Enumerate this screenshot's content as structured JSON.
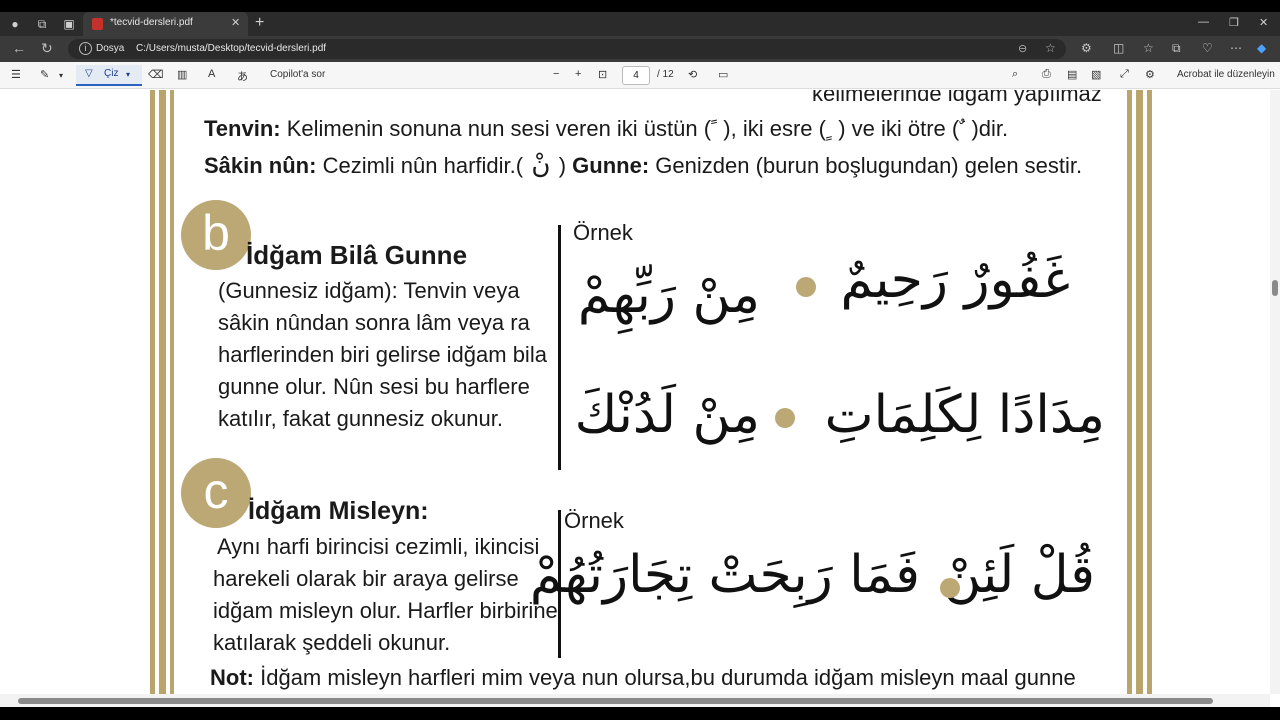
{
  "browser": {
    "tab_title": "*tecvid-dersleri.pdf",
    "site_label": "Dosya",
    "url": "C:/Users/musta/Desktop/tecvid-dersleri.pdf"
  },
  "pdf_toolbar": {
    "draw_label": "Çiz",
    "copilot_label": "Copilot'a sor",
    "page_current": "4",
    "page_total": "/ 12",
    "acrobat_label": "Acrobat ile düzenleyin"
  },
  "page": {
    "top_cut_text": "kelimelerinde idğam yapılmaz",
    "tenvin_term": "Tenvin:",
    "tenvin_def": "Kelimenin sonuna nun sesi veren iki üstün (",
    "tenvin_def2": "), iki esre (",
    "tenvin_def3": ") ve iki ötre (",
    "tenvin_def4": ")dir.",
    "sakin_term": "Sâkin nûn:",
    "sakin_def": "Cezimli nûn harfidir.(",
    "sakin_def2": ")",
    "gunne_term": "Gunne:",
    "gunne_def": "Genizden (burun boşlugundan) gelen sestir.",
    "section_b": {
      "letter": "b",
      "title": "İdğam Bilâ Gunne",
      "lines": [
        "(Gunnesiz idğam): Tenvin veya",
        "sâkin nûndan sonra lâm veya ra",
        "harflerinden biri gelirse idğam bila",
        "gunne olur. Nûn sesi bu harflere",
        "katılır, fakat gunnesiz okunur."
      ],
      "example_label": "Örnek",
      "arabic_1a": "غَفُورٌ رَحِيمٌ",
      "arabic_1b": "مِنْ رَبِّهِمْ",
      "arabic_2a": "مِدَادًا لِكَلِمَاتِ",
      "arabic_2b": "مِنْ لَدُنْكَ"
    },
    "section_c": {
      "letter": "c",
      "title": "İdğam Misleyn:",
      "lines": [
        "Aynı harfi birincisi cezimli, ikincisi",
        "harekeli olarak bir araya gelirse",
        "idğam misleyn olur. Harfler birbirine",
        "katılarak şeddeli okunur."
      ],
      "example_label": "Örnek",
      "arabic_a": "قُلْ لَئِنْ",
      "arabic_b": "فَمَا رَبِحَتْ تِجَارَتُهُمْ"
    },
    "not_term": "Not:",
    "not_text": "İdğam misleyn harfleri mim veya nun olursa,bu durumda idğam misleyn maal gunne"
  },
  "colors": {
    "gold": "#b9a56b",
    "circle": "#bba874"
  }
}
